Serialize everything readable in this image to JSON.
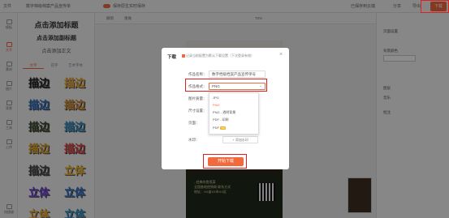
{
  "topbar": {
    "file_menu": "文件",
    "doc_title": "数字档级档案产品宣传单",
    "auto_save": "保存原生实时保存",
    "saved_status": "已保存到云端",
    "share": "分享",
    "export": "导出",
    "download": "下载"
  },
  "rail": {
    "items": [
      "模板",
      "文字",
      "素材",
      "图片",
      "背景",
      "工具",
      "上传",
      "快捷键"
    ]
  },
  "text_panel": {
    "add_title": "点击添加标题",
    "add_subtitle": "点击添加副标题",
    "add_body": "点击添加正文",
    "tabs": [
      "文字",
      "花字",
      "艺术字体"
    ],
    "effects": [
      {
        "text": "描边",
        "color": "#1f1f1f"
      },
      {
        "text": "描边",
        "color": "#f0a830"
      },
      {
        "text": "描边",
        "color": "#2c6ec9"
      },
      {
        "text": "描边",
        "color": "#d98a2a"
      },
      {
        "text": "描边",
        "color": "#3a4a2a"
      },
      {
        "text": "描边",
        "color": "#2c8fc9"
      },
      {
        "text": "描边",
        "color": "#e0a020"
      },
      {
        "text": "描边",
        "color": "#e04040"
      },
      {
        "text": "描边",
        "color": "#444444"
      },
      {
        "text": "立体",
        "color": "#f0b429"
      },
      {
        "text": "立体",
        "color": "#6a3ad9"
      },
      {
        "text": "立体",
        "color": "#2c6ec9"
      },
      {
        "text": "立体",
        "color": "#f0a830"
      },
      {
        "text": "立体",
        "color": "#2c8fc9"
      }
    ]
  },
  "canvas_toolbar": {
    "undo": "撤销",
    "redo": "重做",
    "zoom": "70%"
  },
  "poster": {
    "line1": "- 经典的食用菜",
    "line2": "全国各地经销商 联系方式",
    "line3": "地址：XX省XX市XX区"
  },
  "right_panel": {
    "page_settings": "页面设置",
    "bg_color": "背景颜色",
    "layers": "图层",
    "music": "音乐",
    "comments": "批注"
  },
  "modal": {
    "title": "下载",
    "remember_checkbox": "记录当前配置为默认下载设置（下次登录有效）",
    "close": "×",
    "fields": {
      "name_label": "作品名称：",
      "name_value": "数字档级档案产品宣传单号",
      "format_label": "作品格式：",
      "format_value": "PNG",
      "quality_label": "图片质量：",
      "size_label": "尺寸设置：",
      "size_value": "1:1",
      "scope_label": "页面：",
      "scope_value": "全部页",
      "watermark_label": "水印：",
      "add_watermark": "+ 添加水印"
    },
    "format_options": [
      "JPG",
      "PNG",
      "PNG - 透明背景",
      "PDF - 印刷",
      "PDF"
    ],
    "vip_badge": "VIP",
    "start_button": "开始下载"
  },
  "colors": {
    "accent": "#f06a3e",
    "highlight": "#e02020"
  }
}
